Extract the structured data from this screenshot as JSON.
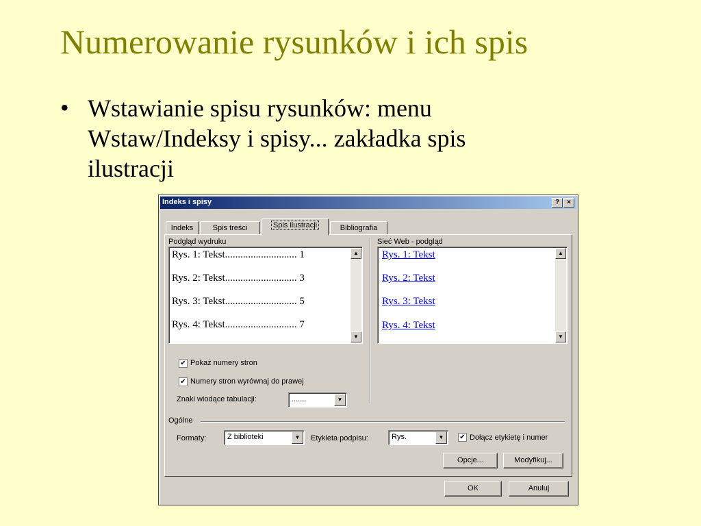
{
  "slide": {
    "title": "Numerowanie rysunków i ich spis",
    "bullet": [
      "Wstawianie spisu rysunków: menu",
      "Wstaw/Indeksy i spisy... zakładka spis",
      "ilustracji"
    ]
  },
  "dialog": {
    "title": "Indeks i spisy",
    "help_label": "?",
    "close_label": "×",
    "tabs": [
      {
        "label": "Indeks"
      },
      {
        "label": "Spis treści"
      },
      {
        "label": "Spis ilustracji"
      },
      {
        "label": "Bibliografia"
      }
    ],
    "print_preview": {
      "label": "Podgląd wydruku",
      "rows": [
        {
          "text": "Rys. 1: Tekst",
          "leader": "............................",
          "page": "1"
        },
        {
          "text": "Rys. 2: Tekst",
          "leader": "............................",
          "page": "3"
        },
        {
          "text": "Rys. 3: Tekst",
          "leader": "............................",
          "page": "5"
        },
        {
          "text": "Rys. 4: Tekst",
          "leader": "............................",
          "page": "7"
        }
      ]
    },
    "web_preview": {
      "label": "Sieć Web - podgląd",
      "links": [
        "Rys. 1: Tekst",
        "Rys. 2: Tekst",
        "Rys. 3: Tekst",
        "Rys. 4: Tekst"
      ]
    },
    "show_page_numbers": {
      "label": "Pokaż numery stron",
      "checked": true
    },
    "right_align": {
      "label": "Numery stron wyrównaj do prawej",
      "checked": true
    },
    "tab_leader": {
      "label": "Znaki wiodące tabulacji:",
      "value": "......."
    },
    "general_label": "Ogólne",
    "formats": {
      "label": "Formaty:",
      "value": "Z biblioteki"
    },
    "caption_label": {
      "label": "Etykieta podpisu:",
      "value": "Rys."
    },
    "include_label": {
      "label": "Dołącz etykietę i numer",
      "checked": true
    },
    "options_button": "Opcje...",
    "modify_button": "Modyfikuj...",
    "ok_button": "OK",
    "cancel_button": "Anuluj",
    "check_glyph": "✔",
    "arrow_down": "▼",
    "arrow_up": "▲"
  }
}
